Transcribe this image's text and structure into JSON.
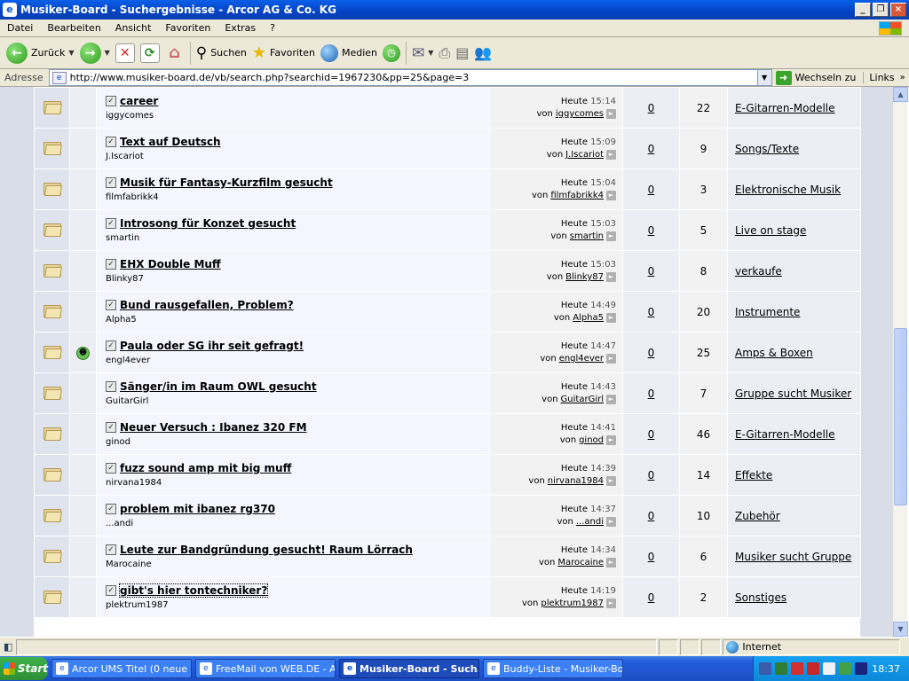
{
  "window": {
    "title": "Musiker-Board - Suchergebnisse - Arcor AG & Co. KG"
  },
  "menu": [
    "Datei",
    "Bearbeiten",
    "Ansicht",
    "Favoriten",
    "Extras",
    "?"
  ],
  "toolbar": {
    "back": "Zurück",
    "search": "Suchen",
    "favorites": "Favoriten",
    "media": "Medien"
  },
  "address": {
    "label": "Adresse",
    "url": "http://www.musiker-board.de/vb/search.php?searchid=1967230&pp=25&page=3",
    "go": "Wechseln zu",
    "links": "Links"
  },
  "threads": [
    {
      "title": "career",
      "author": "iggycomes",
      "day": "Heute",
      "time": "15:14",
      "by_prefix": "von",
      "last_poster": "iggycomes",
      "replies": "0",
      "views": "22",
      "forum": "E-Gitarren-Modelle",
      "icon": ""
    },
    {
      "title": "Text auf Deutsch",
      "author": "J.Iscariot",
      "day": "Heute",
      "time": "15:09",
      "by_prefix": "von",
      "last_poster": "J.Iscariot",
      "replies": "0",
      "views": "9",
      "forum": "Songs/Texte",
      "icon": ""
    },
    {
      "title": "Musik für Fantasy-Kurzfilm gesucht",
      "author": "filmfabrikk4",
      "day": "Heute",
      "time": "15:04",
      "by_prefix": "von",
      "last_poster": "filmfabrikk4",
      "replies": "0",
      "views": "3",
      "forum": "Elektronische Musik",
      "icon": ""
    },
    {
      "title": "Introsong für Konzet gesucht",
      "author": "smartin",
      "day": "Heute",
      "time": "15:03",
      "by_prefix": "von",
      "last_poster": "smartin",
      "replies": "0",
      "views": "5",
      "forum": "Live on stage",
      "icon": ""
    },
    {
      "title": "EHX Double Muff",
      "author": "Blinky87",
      "day": "Heute",
      "time": "15:03",
      "by_prefix": "von",
      "last_poster": "Blinky87",
      "replies": "0",
      "views": "8",
      "forum": "verkaufe",
      "icon": ""
    },
    {
      "title": "Bund rausgefallen, Problem?",
      "author": "Alpha5",
      "day": "Heute",
      "time": "14:49",
      "by_prefix": "von",
      "last_poster": "Alpha5",
      "replies": "0",
      "views": "20",
      "forum": "Instrumente",
      "icon": ""
    },
    {
      "title": "Paula oder SG ihr seit gefragt!",
      "author": "engl4ever",
      "day": "Heute",
      "time": "14:47",
      "by_prefix": "von",
      "last_poster": "engl4ever",
      "replies": "0",
      "views": "25",
      "forum": "Amps & Boxen",
      "icon": "grin"
    },
    {
      "title": "Sänger/in im Raum OWL gesucht",
      "author": "GuitarGirl",
      "day": "Heute",
      "time": "14:43",
      "by_prefix": "von",
      "last_poster": "GuitarGirl",
      "replies": "0",
      "views": "7",
      "forum": "Gruppe sucht Musiker",
      "icon": ""
    },
    {
      "title": "Neuer Versuch : Ibanez 320 FM",
      "author": "ginod",
      "day": "Heute",
      "time": "14:41",
      "by_prefix": "von",
      "last_poster": "ginod",
      "replies": "0",
      "views": "46",
      "forum": "E-Gitarren-Modelle",
      "icon": ""
    },
    {
      "title": "fuzz sound amp mit big muff",
      "author": "nirvana1984",
      "day": "Heute",
      "time": "14:39",
      "by_prefix": "von",
      "last_poster": "nirvana1984",
      "replies": "0",
      "views": "14",
      "forum": "Effekte",
      "icon": ""
    },
    {
      "title": "problem mit ibanez rg370",
      "author": "...andi",
      "day": "Heute",
      "time": "14:37",
      "by_prefix": "von",
      "last_poster": "...andi",
      "replies": "0",
      "views": "10",
      "forum": "Zubehör",
      "icon": ""
    },
    {
      "title": "Leute zur Bandgründung gesucht! Raum Lörrach",
      "author": "Marocaine",
      "day": "Heute",
      "time": "14:34",
      "by_prefix": "von",
      "last_poster": "Marocaine",
      "replies": "0",
      "views": "6",
      "forum": "Musiker sucht Gruppe",
      "icon": ""
    },
    {
      "title": "gibt's hier tontechniker?",
      "author": "plektrum1987",
      "day": "Heute",
      "time": "14:19",
      "by_prefix": "von",
      "last_poster": "plektrum1987",
      "replies": "0",
      "views": "2",
      "forum": "Sonstiges",
      "icon": ""
    }
  ],
  "status": {
    "zone": "Internet"
  },
  "taskbar": {
    "start": "Start",
    "tasks": [
      {
        "label": "Arcor UMS Titel (0 neue ...",
        "active": false
      },
      {
        "label": "FreeMail von WEB.DE - A...",
        "active": false
      },
      {
        "label": "Musiker-Board - Such...",
        "active": true
      },
      {
        "label": "Buddy-Liste - Musiker-Bo...",
        "active": false
      }
    ],
    "clock": "18:37"
  }
}
